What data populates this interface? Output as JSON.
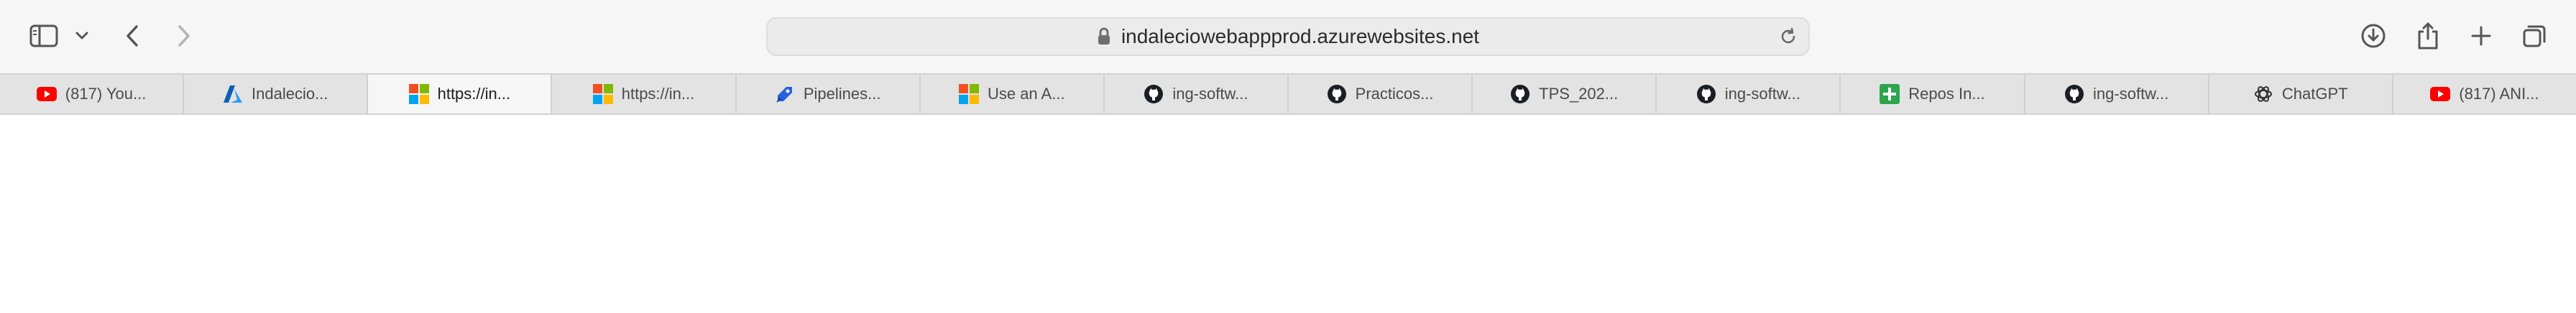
{
  "toolbar": {
    "url": "indaleciowebappprod.azurewebsites.net",
    "icons": [
      "sidebar-icon",
      "chevron-down-icon",
      "back-icon",
      "forward-icon",
      "lock-icon",
      "reload-icon",
      "download-icon",
      "share-icon",
      "new-tab-icon",
      "tab-overview-icon"
    ]
  },
  "tabs": [
    {
      "label": "(817) You...",
      "icon": "youtube-icon",
      "active": false
    },
    {
      "label": "Indalecio...",
      "icon": "azure-icon",
      "active": false
    },
    {
      "label": "https://in...",
      "icon": "microsoft-icon",
      "active": true
    },
    {
      "label": "https://in...",
      "icon": "microsoft-icon",
      "active": false
    },
    {
      "label": "Pipelines...",
      "icon": "azure-pipelines-icon",
      "active": false
    },
    {
      "label": "Use an A...",
      "icon": "microsoft-icon",
      "active": false
    },
    {
      "label": "ing-softw...",
      "icon": "github-icon",
      "active": false
    },
    {
      "label": "Practicos...",
      "icon": "github-icon",
      "active": false
    },
    {
      "label": "TPS_202...",
      "icon": "github-icon",
      "active": false
    },
    {
      "label": "ing-softw...",
      "icon": "github-icon",
      "active": false
    },
    {
      "label": "Repos In...",
      "icon": "plus-board-icon",
      "active": false
    },
    {
      "label": "ing-softw...",
      "icon": "github-icon",
      "active": false
    },
    {
      "label": "ChatGPT",
      "icon": "chatgpt-icon",
      "active": false
    },
    {
      "label": "(817) ANI...",
      "icon": "youtube-icon",
      "active": false
    }
  ],
  "colors": {
    "toolbar_bg": "#f6f6f6",
    "tabbar_bg": "#e3e3e3",
    "active_tab_bg": "#f6f6f6",
    "youtube_red": "#ff0000",
    "azure_blue": "#0078d4",
    "github_black": "#1b1f23",
    "plus_green": "#2da44e"
  }
}
